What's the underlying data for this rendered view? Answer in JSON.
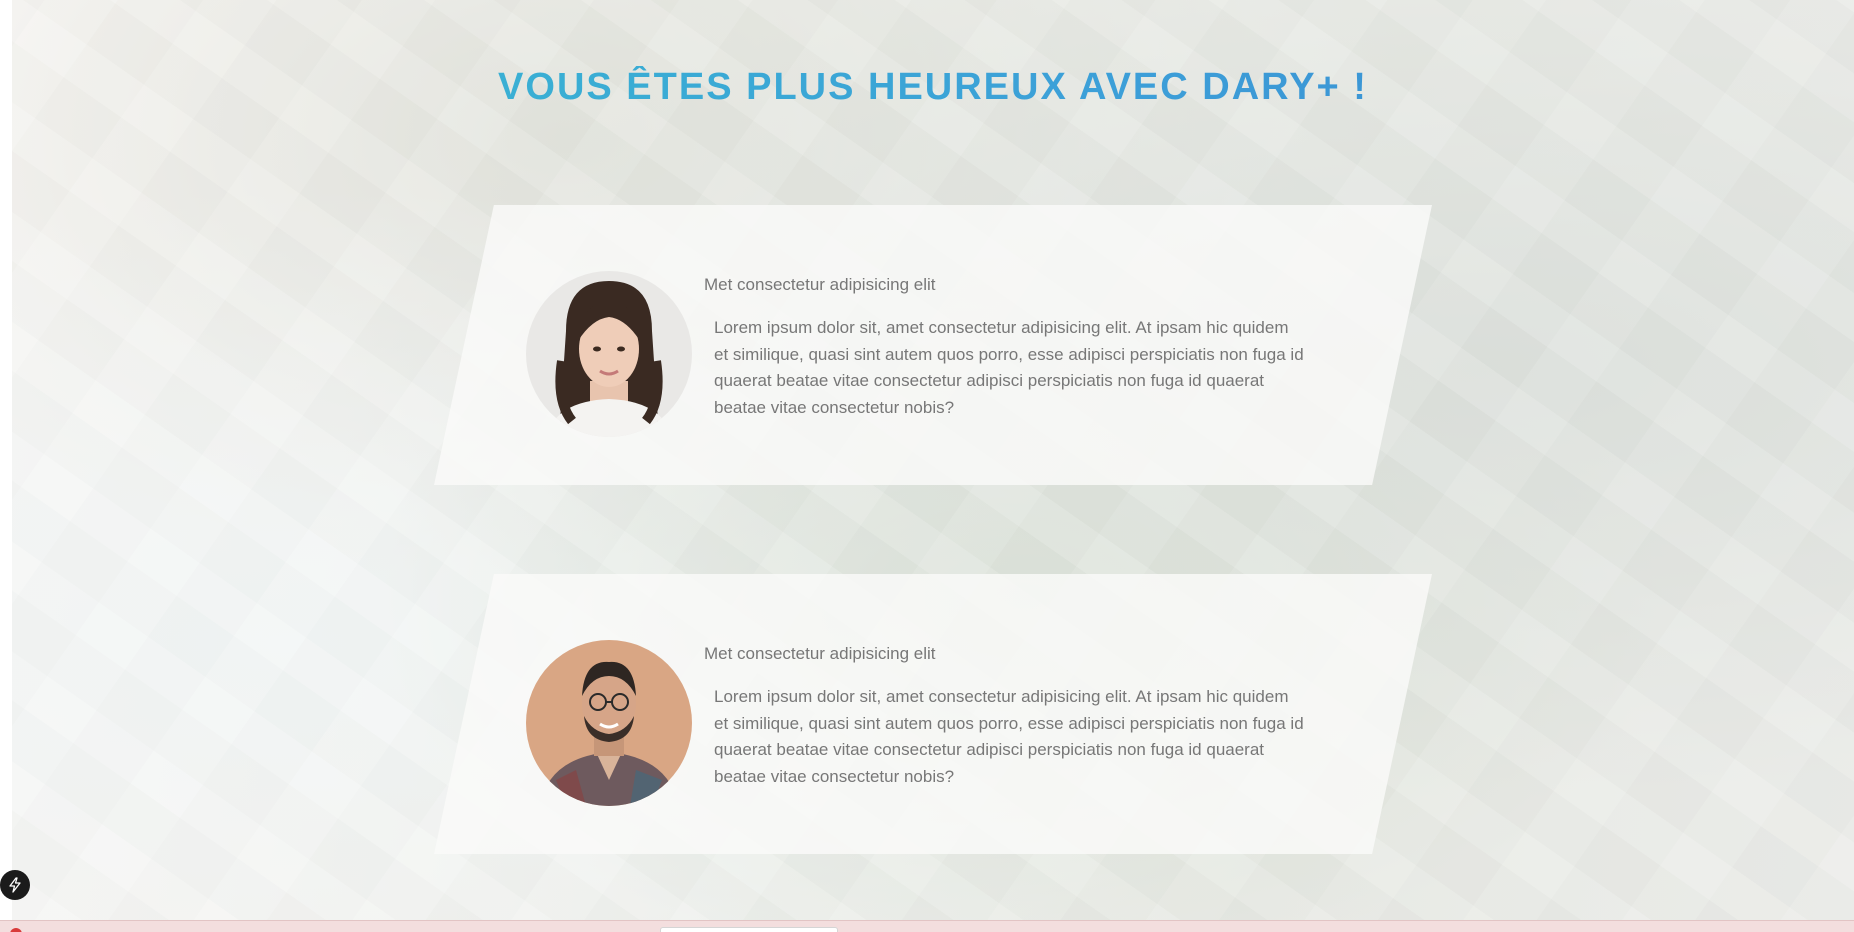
{
  "section": {
    "heading": "VOUS ÊTES PLUS HEUREUX AVEC DARY+ !"
  },
  "testimonials": [
    {
      "title": "Met consectetur adipisicing elit",
      "text": "Lorem ipsum dolor sit, amet consectetur adipisicing elit. At ipsam hic quidem\n et similique, quasi sint autem quos porro, esse adipisci perspiciatis non fuga id\n quaerat beatae vitae consectetur adipisci perspiciatis non fuga id quaerat\nbeatae vitae consectetur nobis?",
      "avatar": "woman-portrait"
    },
    {
      "title": "Met consectetur adipisicing elit",
      "text": "Lorem ipsum dolor sit, amet consectetur adipisicing elit. At ipsam hic quidem\n et similique, quasi sint autem quos porro, esse adipisci perspiciatis non fuga id\n quaerat beatae vitae consectetur adipisci perspiciatis non fuga id quaerat\nbeatae vitae consectetur nobis?",
      "avatar": "man-portrait"
    }
  ],
  "colors": {
    "heading_start": "#38bcd0",
    "heading_end": "#3a86d0",
    "body_text": "#777777"
  },
  "icons": {
    "floating_button": "lightning-bolt-icon"
  }
}
